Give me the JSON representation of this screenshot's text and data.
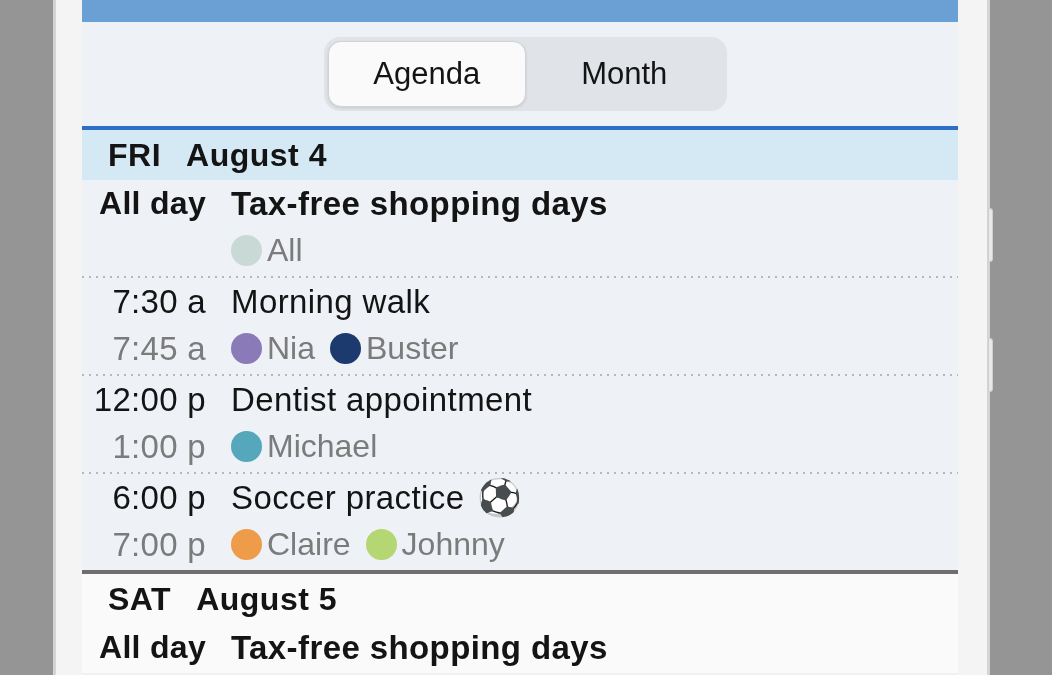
{
  "view_switcher": {
    "tabs": [
      {
        "label": "Agenda",
        "selected": true
      },
      {
        "label": "Month",
        "selected": false
      }
    ]
  },
  "days": [
    {
      "weekday": "FRI",
      "date": "August 4",
      "highlighted": true,
      "events": [
        {
          "kind": "all_day",
          "time": "All day",
          "title": "Tax-free shopping days",
          "participants": [
            {
              "name": "All",
              "color": "#c9d9d6"
            }
          ]
        },
        {
          "kind": "timed",
          "start": "7:30 a",
          "end": "7:45 a",
          "title": "Morning walk",
          "participants": [
            {
              "name": "Nia",
              "color": "#8a7bb8"
            },
            {
              "name": "Buster",
              "color": "#1c3a6d"
            }
          ]
        },
        {
          "kind": "timed",
          "start": "12:00 p",
          "end": "1:00 p",
          "title": "Dentist appointment",
          "participants": [
            {
              "name": "Michael",
              "color": "#55a7bb"
            }
          ]
        },
        {
          "kind": "timed",
          "start": "6:00 p",
          "end": "7:00 p",
          "title": "Soccer practice",
          "emoji": "⚽",
          "participants": [
            {
              "name": "Claire",
              "color": "#ee9c4a"
            },
            {
              "name": "Johnny",
              "color": "#b4d673"
            }
          ]
        }
      ]
    },
    {
      "weekday": "SAT",
      "date": "August 5",
      "highlighted": false,
      "events": [
        {
          "kind": "all_day",
          "time": "All day",
          "title": "Tax-free shopping days"
        }
      ]
    }
  ]
}
